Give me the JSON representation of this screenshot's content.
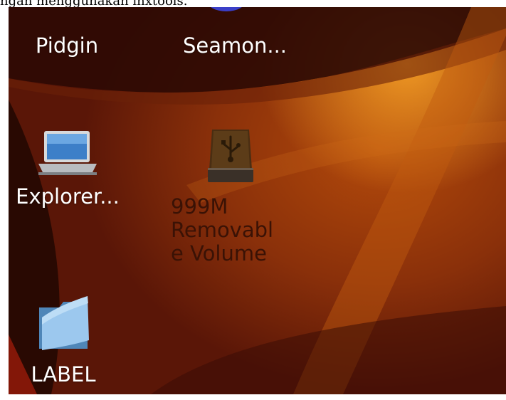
{
  "caption": "ngan menggunakan inxtools.",
  "desktop": {
    "icons": [
      {
        "label": "Pidgin",
        "icon": "pidgin-icon"
      },
      {
        "label": "Seamon...",
        "icon": "seamonkey-icon"
      },
      {
        "label": "Explorer...",
        "icon": "laptop-icon"
      },
      {
        "label_lines": [
          "999M",
          "Removabl",
          "e Volume"
        ],
        "icon": "usb-drive-icon"
      },
      {
        "label": "LABEL",
        "icon": "folder-icon"
      }
    ]
  }
}
